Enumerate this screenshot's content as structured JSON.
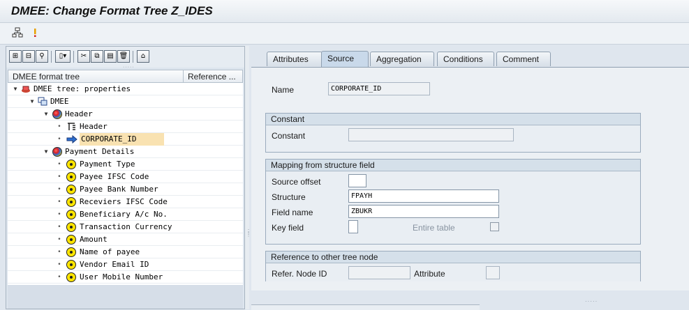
{
  "window": {
    "title": "DMEE: Change Format Tree Z_IDES"
  },
  "app_toolbar": {
    "icons": [
      "hierarchy-icon",
      "info-icon"
    ]
  },
  "tree_toolbar": {
    "icons": [
      "expand-icon",
      "collapse-icon",
      "find-icon",
      "create-icon",
      "cut-icon",
      "copy-icon",
      "paste-icon",
      "delete-icon",
      "hierarchy-nav-icon"
    ]
  },
  "tree": {
    "col_header": "DMEE format tree",
    "col_reference": "Reference ...",
    "nodes": [
      {
        "label": "DMEE tree: properties",
        "icon": "tree-props-icon",
        "level": 0,
        "twisty": "open"
      },
      {
        "label": "DMEE",
        "icon": "segment-icon",
        "level": 1,
        "twisty": "open"
      },
      {
        "label": "Header",
        "icon": "structure-icon",
        "level": 2,
        "twisty": "open"
      },
      {
        "label": "Header",
        "icon": "header-node-icon",
        "level": 3
      },
      {
        "label": "CORPORATE_ID",
        "icon": "arrow-right-icon",
        "level": 3,
        "selected": true
      },
      {
        "label": "Payment Details",
        "icon": "structure-icon",
        "level": 2,
        "twisty": "open"
      },
      {
        "label": "Payment Type",
        "icon": "field-icon",
        "level": 3
      },
      {
        "label": "Payee IFSC Code",
        "icon": "field-icon",
        "level": 3
      },
      {
        "label": "Payee Bank Number",
        "icon": "field-icon",
        "level": 3
      },
      {
        "label": "Receviers IFSC Code",
        "icon": "field-icon",
        "level": 3
      },
      {
        "label": "Beneficiary A/c No.",
        "icon": "field-icon",
        "level": 3
      },
      {
        "label": "Transaction Currency",
        "icon": "field-icon",
        "level": 3
      },
      {
        "label": "Amount",
        "icon": "field-icon",
        "level": 3
      },
      {
        "label": "Name of payee",
        "icon": "field-icon",
        "level": 3
      },
      {
        "label": "Vendor Email ID",
        "icon": "field-icon",
        "level": 3
      },
      {
        "label": "User Mobile Number",
        "icon": "field-icon",
        "level": 3
      }
    ]
  },
  "tabs": [
    "Attributes",
    "Source",
    "Aggregation",
    "Conditions",
    "Comment"
  ],
  "active_tab": "Source",
  "form": {
    "name_label": "Name",
    "name_value": "CORPORATE_ID",
    "constant_group": "Constant",
    "constant_label": "Constant",
    "constant_value": "",
    "mapping_group": "Mapping from structure field",
    "source_offset_label": "Source offset",
    "source_offset_value": "",
    "structure_label": "Structure",
    "structure_value": "FPAYH",
    "field_name_label": "Field name",
    "field_name_value": "ZBUKR",
    "key_field_label": "Key field",
    "entire_table_label": "Entire table",
    "entire_table_checked": false,
    "reference_group": "Reference to other tree node",
    "refer_node_label": "Refer. Node ID",
    "refer_node_value": "",
    "attribute_label": "Attribute",
    "attribute_value": ""
  },
  "colors": {
    "selection": "#f9e2b1",
    "panel_bg": "#ecf0f4",
    "tab_active": "#c9d9ea"
  }
}
